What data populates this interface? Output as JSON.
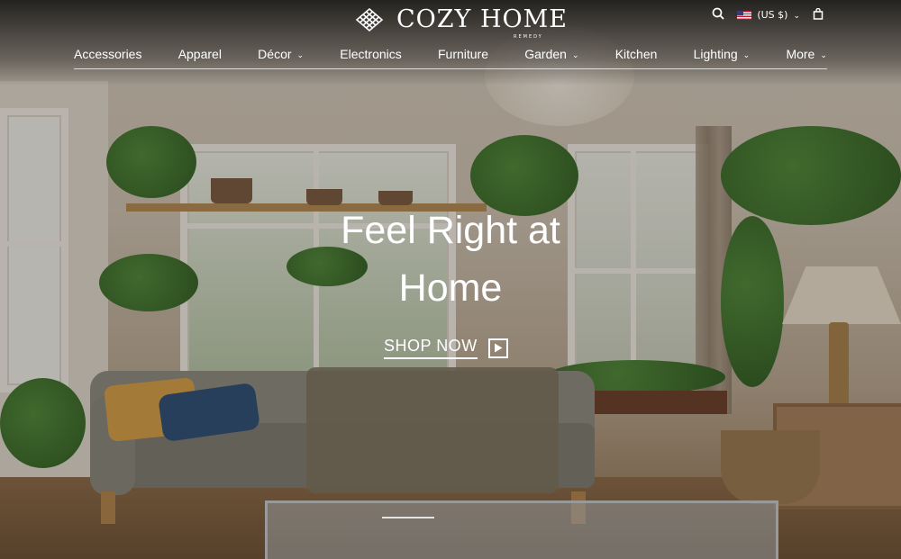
{
  "brand": {
    "name": "COZY HOME",
    "tagline": "REMEDY",
    "logo_icon": "diamond-lattice-icon"
  },
  "utility": {
    "search_icon": "search-icon",
    "currency_label": "(US $)",
    "currency_flag": "us-flag-icon",
    "cart_icon": "shopping-bag-icon"
  },
  "nav": {
    "items": [
      {
        "label": "Accessories",
        "has_dropdown": false
      },
      {
        "label": "Apparel",
        "has_dropdown": false
      },
      {
        "label": "Décor",
        "has_dropdown": true
      },
      {
        "label": "Electronics",
        "has_dropdown": false
      },
      {
        "label": "Furniture",
        "has_dropdown": false
      },
      {
        "label": "Garden",
        "has_dropdown": true
      },
      {
        "label": "Kitchen",
        "has_dropdown": false
      },
      {
        "label": "Lighting",
        "has_dropdown": true
      },
      {
        "label": "More",
        "has_dropdown": true
      }
    ]
  },
  "hero": {
    "title_line1": "Feel Right at",
    "title_line2": "Home",
    "cta_label": "SHOP NOW",
    "cta_icon": "play-icon"
  },
  "colors": {
    "text": "#ffffff",
    "overlay": "#1e140a"
  }
}
